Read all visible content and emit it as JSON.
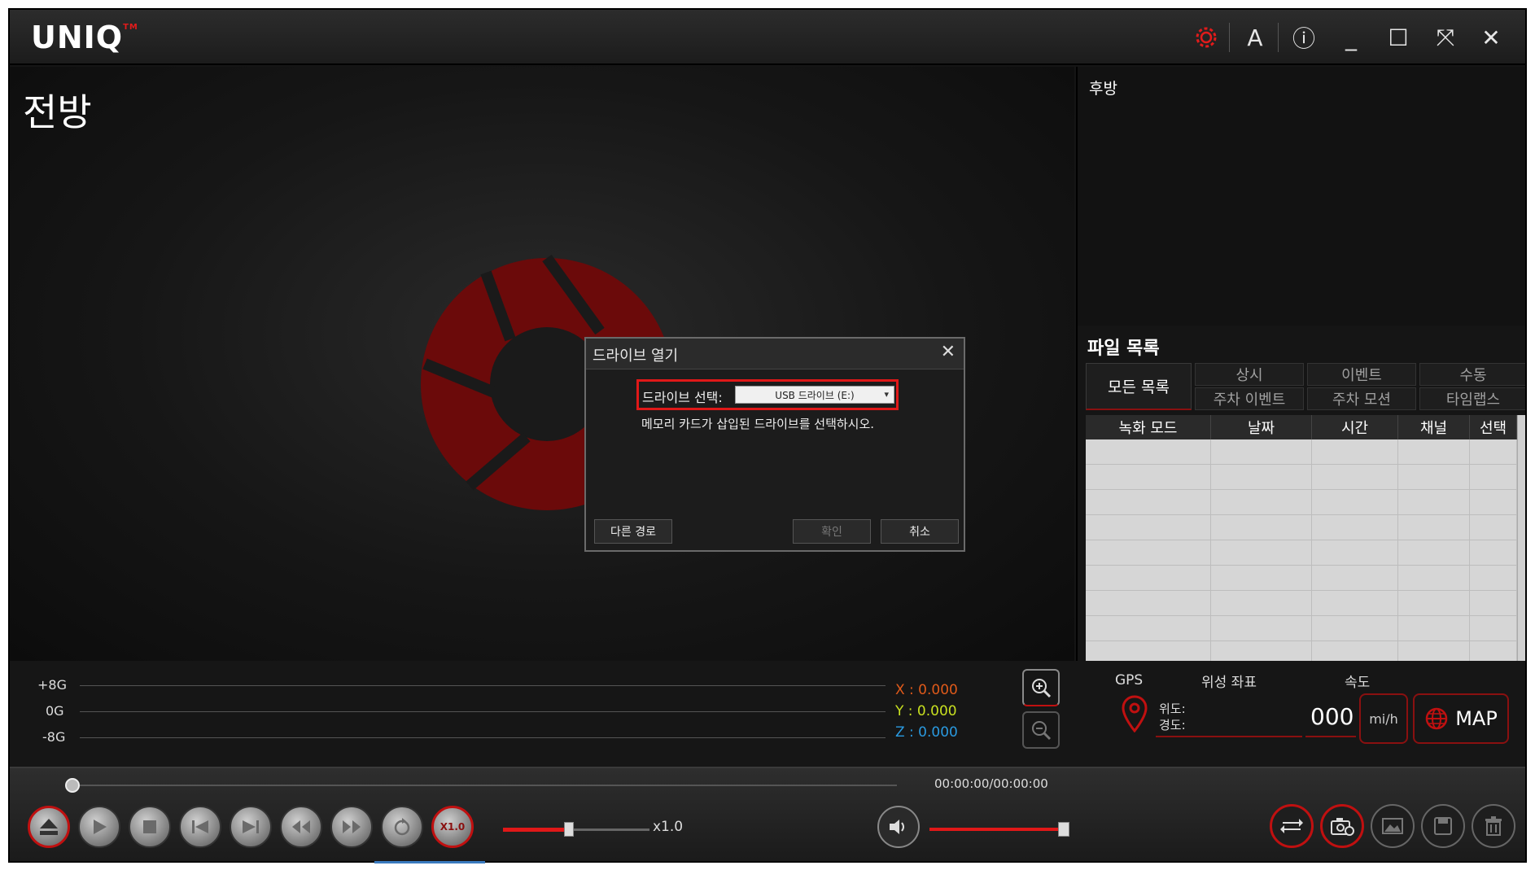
{
  "title_bar": {
    "logo": "UNIQ",
    "logo_tm": "TM",
    "font_btn": "A",
    "info_btn": "ⓘ",
    "minimize_btn": "_",
    "maximize_btn": "☐",
    "fullscreen_btn": "⤧",
    "close_btn": "✕",
    "accent_color": "#e21b1b"
  },
  "front": {
    "label": "전방"
  },
  "rear": {
    "label": "후방"
  },
  "file_list": {
    "title": "파일 목록",
    "all_button": "모든 목록",
    "filters": [
      "상시",
      "이벤트",
      "수동",
      "주차 이벤트",
      "주차 모션",
      "타임랩스"
    ],
    "columns": [
      "녹화 모드",
      "날짜",
      "시간",
      "채널",
      "선택"
    ],
    "rows": 9
  },
  "gsensor": {
    "labels": [
      "+8G",
      "0G",
      "-8G"
    ],
    "x": "X : 0.000",
    "y": "Y : 0.000",
    "z": "Z : 0.000",
    "x_color": "#e05a1a",
    "y_color": "#c8e020",
    "z_color": "#2a9ae0"
  },
  "gps": {
    "label": "GPS",
    "coords_title": "위성 좌표",
    "lat": "위도:",
    "lon": "경도:",
    "speed_title": "속도",
    "speed_value": "000",
    "unit": "mi/h",
    "map": "MAP"
  },
  "playback": {
    "time": "00:00:00/00:00:00",
    "speed_label": "x1.0",
    "speed_icon": "X1.0",
    "speed_progress": 0.45,
    "volume_level": 0.97
  },
  "dialog": {
    "title": "드라이브 열기",
    "select_label": "드라이브 선택:",
    "select_value": "USB 드라이브 (E:)",
    "help": "메모리 카드가 삽입된 드라이브를 선택하시오.",
    "other_path": "다른 경로",
    "ok": "확인",
    "cancel": "취소"
  }
}
